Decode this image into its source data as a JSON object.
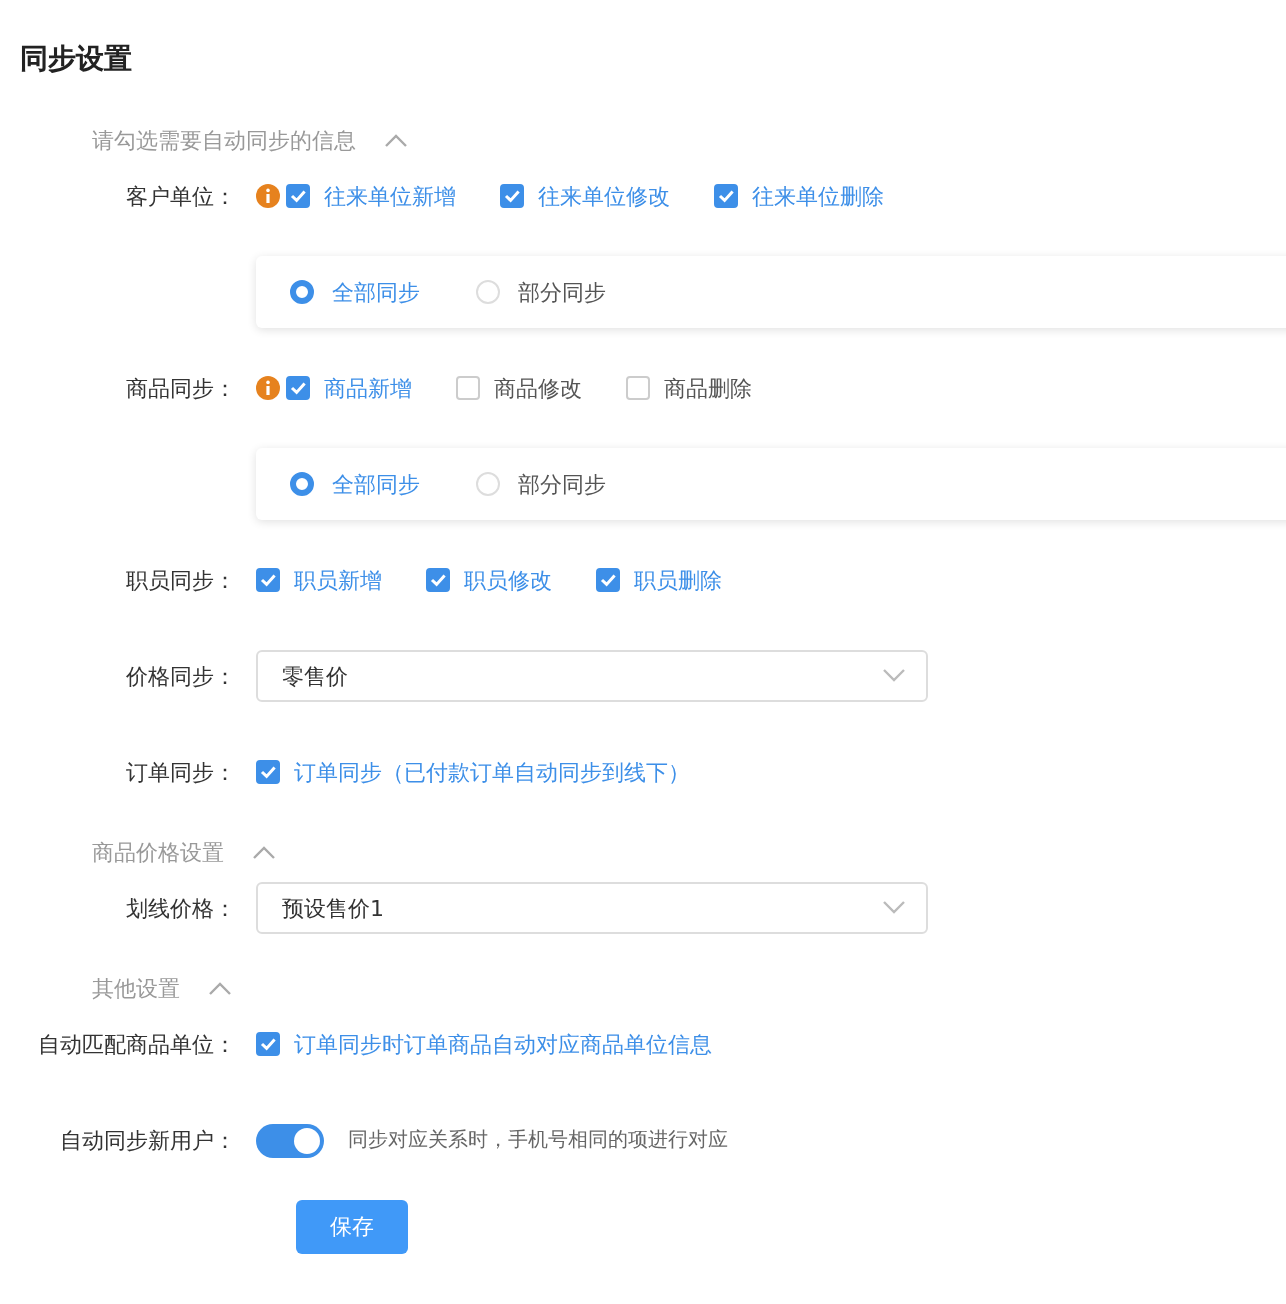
{
  "title": "同步设置",
  "sections": [
    {
      "title": "请勾选需要自动同步的信息",
      "expanded": true,
      "rows": [
        {
          "kind": "checks",
          "label": "客户单位：",
          "info": true,
          "options": [
            {
              "label": "往来单位新增",
              "checked": true
            },
            {
              "label": "往来单位修改",
              "checked": true
            },
            {
              "label": "往来单位删除",
              "checked": true
            }
          ]
        },
        {
          "kind": "radios",
          "options": [
            {
              "label": "全部同步",
              "selected": true
            },
            {
              "label": "部分同步",
              "selected": false
            }
          ]
        },
        {
          "kind": "checks",
          "label": "商品同步：",
          "info": true,
          "options": [
            {
              "label": "商品新增",
              "checked": true
            },
            {
              "label": "商品修改",
              "checked": false
            },
            {
              "label": "商品删除",
              "checked": false
            }
          ]
        },
        {
          "kind": "radios",
          "options": [
            {
              "label": "全部同步",
              "selected": true
            },
            {
              "label": "部分同步",
              "selected": false
            }
          ]
        },
        {
          "kind": "checks",
          "label": "职员同步：",
          "info": false,
          "options": [
            {
              "label": "职员新增",
              "checked": true
            },
            {
              "label": "职员修改",
              "checked": true
            },
            {
              "label": "职员删除",
              "checked": true
            }
          ]
        },
        {
          "kind": "select",
          "label": "价格同步：",
          "value": "零售价"
        },
        {
          "kind": "checks",
          "label": "订单同步：",
          "info": false,
          "options": [
            {
              "label": "订单同步（已付款订单自动同步到线下）",
              "checked": true
            }
          ]
        }
      ]
    },
    {
      "title": "商品价格设置",
      "expanded": true,
      "rows": [
        {
          "kind": "select",
          "label": "划线价格：",
          "value": "预设售价1"
        }
      ]
    },
    {
      "title": "其他设置",
      "expanded": true,
      "rows": [
        {
          "kind": "checks",
          "label": "自动匹配商品单位：",
          "info": false,
          "options": [
            {
              "label": "订单同步时订单商品自动对应商品单位信息",
              "checked": true
            }
          ]
        },
        {
          "kind": "toggle",
          "label": "自动同步新用户：",
          "on": true,
          "hint": "同步对应关系时，手机号相同的项进行对应"
        }
      ]
    }
  ],
  "save_button": "保存"
}
